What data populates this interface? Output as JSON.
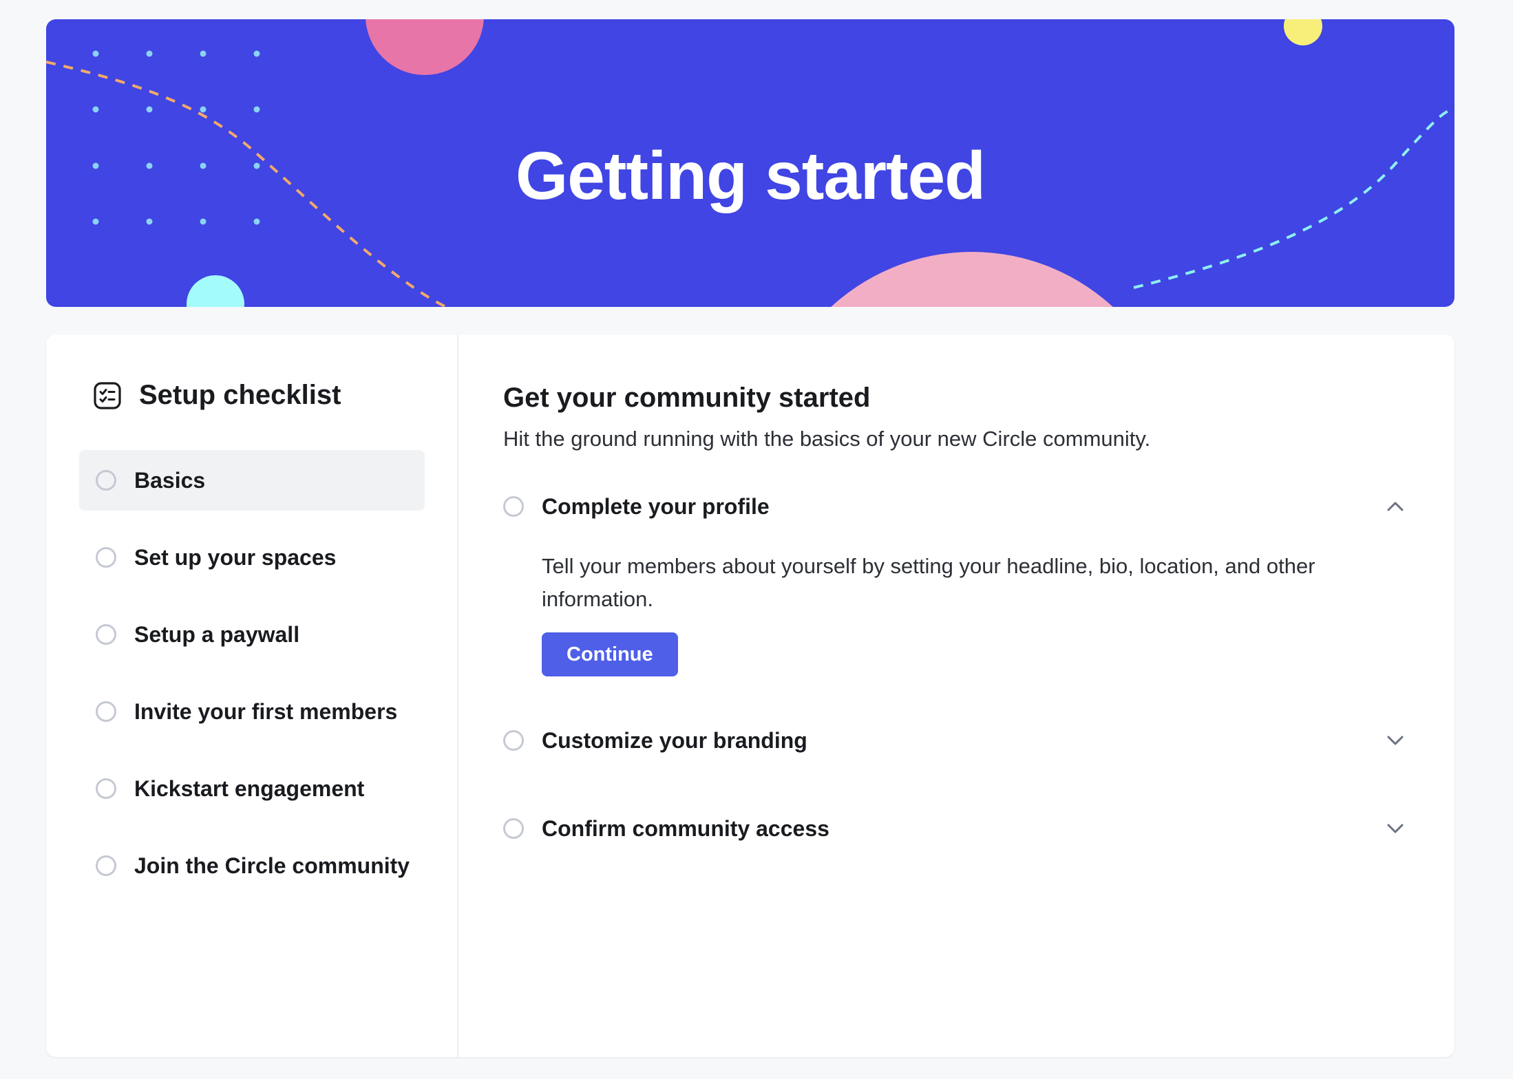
{
  "hero": {
    "title": "Getting started"
  },
  "sidebar": {
    "title": "Setup checklist",
    "icon": "checklist-icon",
    "items": [
      {
        "label": "Basics",
        "active": true
      },
      {
        "label": "Set up your spaces",
        "active": false
      },
      {
        "label": "Setup a paywall",
        "active": false
      },
      {
        "label": "Invite your first members",
        "active": false
      },
      {
        "label": "Kickstart engagement",
        "active": false
      },
      {
        "label": "Join the Circle community",
        "active": false
      }
    ]
  },
  "main": {
    "title": "Get your community started",
    "subtitle": "Hit the ground running with the basics of your new Circle community.",
    "tasks": [
      {
        "label": "Complete your profile",
        "expanded": true,
        "description": "Tell your members about yourself by setting your headline, bio, location, and other information.",
        "button_label": "Continue",
        "chevron_icon": "chevron-up-icon"
      },
      {
        "label": "Customize your branding",
        "expanded": false,
        "chevron_icon": "chevron-down-icon"
      },
      {
        "label": "Confirm community access",
        "expanded": false,
        "chevron_icon": "chevron-down-icon"
      }
    ]
  },
  "colors": {
    "hero_bg": "#4045e3",
    "button_bg": "#4f5fe8",
    "active_item_bg": "#f1f2f4",
    "circle_border": "#c5c9d3"
  }
}
